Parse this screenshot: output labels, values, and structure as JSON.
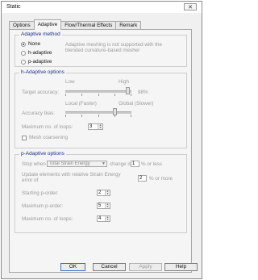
{
  "window": {
    "title": "Static",
    "close_icon": "✕"
  },
  "tabs": [
    "Options",
    "Adaptive",
    "Flow/Thermal Effects",
    "Remark"
  ],
  "adaptive_method": {
    "label": "Adaptive method",
    "options": [
      "None",
      "h-adaptive",
      "p-adaptive"
    ],
    "selected": "None",
    "note_line1": "Adaptive meshing is not supported with the",
    "note_line2": "blended curvature-based mesher"
  },
  "h_adaptive": {
    "label": "h-Adaptive options",
    "low": "Low",
    "high": "High",
    "target_accuracy_label": "Target accuracy:",
    "target_accuracy_value": "98%",
    "target_accuracy_level": 0.95,
    "local_label": "Local (Faster)",
    "global_label": "Global (Slower)",
    "accuracy_bias_label": "Accuracy bias:",
    "accuracy_bias_level": 0.75,
    "max_loops_label": "Maximum no. of loops:",
    "max_loops_value": "3",
    "mesh_coarsening_label": "Mesh coarsening"
  },
  "p_adaptive": {
    "label": "p-Adaptive options",
    "stop_when_label": "Stop when",
    "stop_when_value": "Total Strain Energy",
    "change_label": "change is",
    "change_value": "1",
    "change_unit": "% or less",
    "update_line1": "Update elements with relative Strain Energy",
    "update_line2": "error of",
    "update_value": "2",
    "update_unit": "% or more",
    "starting_order_label": "Starting p-order:",
    "starting_order_value": "2",
    "max_order_label": "Maximum p-order:",
    "max_order_value": "5",
    "max_loops_label": "Maximum no. of loops:",
    "max_loops_value": "4"
  },
  "buttons": {
    "ok": "OK",
    "cancel": "Cancel",
    "apply": "Apply",
    "help": "Help"
  }
}
